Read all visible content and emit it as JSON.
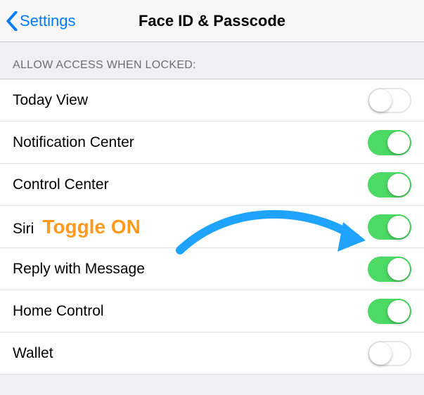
{
  "nav": {
    "back_label": "Settings",
    "title": "Face ID & Passcode"
  },
  "section": {
    "header": "ALLOW ACCESS WHEN LOCKED:"
  },
  "rows": {
    "today_view": {
      "label": "Today View",
      "on": false
    },
    "notification_center": {
      "label": "Notification Center",
      "on": true
    },
    "control_center": {
      "label": "Control Center",
      "on": true
    },
    "siri": {
      "label": "Siri",
      "on": true
    },
    "reply_message": {
      "label": "Reply with Message",
      "on": true
    },
    "home_control": {
      "label": "Home Control",
      "on": true
    },
    "wallet": {
      "label": "Wallet",
      "on": false
    }
  },
  "annotation": {
    "text": "Toggle ON"
  }
}
